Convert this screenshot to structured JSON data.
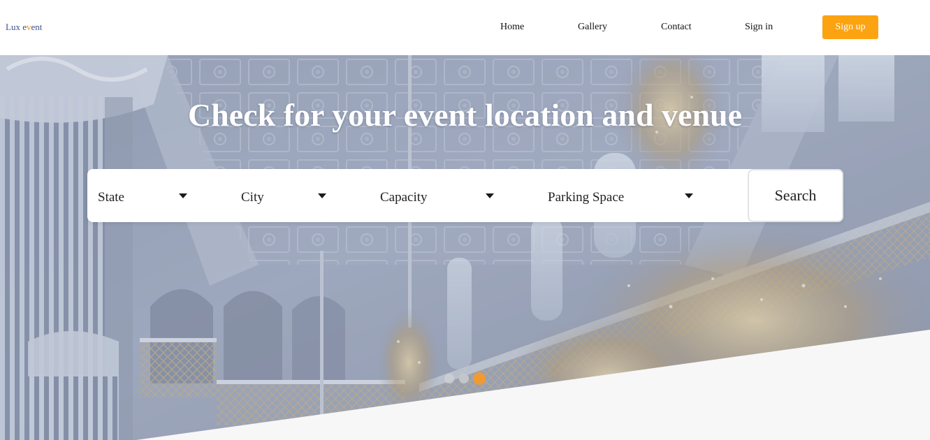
{
  "brand": {
    "name_part1": "Lux e",
    "name_accent": "v",
    "name_part2": "ent"
  },
  "nav": {
    "home": "Home",
    "gallery": "Gallery",
    "contact": "Contact",
    "signin": "Sign in",
    "signup": "Sign up"
  },
  "hero": {
    "title": "Check for your event location and venue",
    "background": "ornate palace ballroom with chandeliers"
  },
  "search": {
    "state": "State",
    "city": "City",
    "capacity": "Capacity",
    "parking": "Parking Space",
    "button": "Search"
  },
  "carousel": {
    "slides": 3,
    "active_index": 3
  },
  "colors": {
    "accent": "#fca311",
    "active_dot": "#ef9a33",
    "brand_text": "#3d4f8a",
    "section_bg": "#f7f7f7"
  },
  "icons": {
    "dropdown": "caret-down-icon"
  }
}
